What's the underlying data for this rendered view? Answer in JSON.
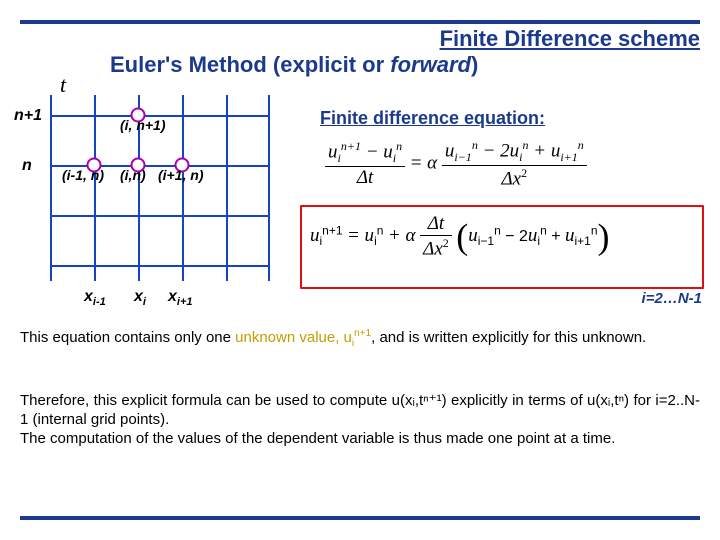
{
  "title_line1": "Finite Difference scheme",
  "title_line2_a": "Euler's Method (explicit or ",
  "title_line2_b": "forward",
  "title_line2_c": ")",
  "t_label": "t",
  "y_n1": "n+1",
  "y_n": "n",
  "stencil": {
    "top": "(i, n+1)",
    "left": "(i-1, n)",
    "mid": "(i,n)",
    "right": "(i+1, n)"
  },
  "xticks": {
    "xm1": "x",
    "xm1s": "i-1",
    "xi": "x",
    "xis": "i",
    "xp1": "x",
    "xp1s": "i+1"
  },
  "eq_heading": "Finite difference equation:",
  "range_note": "i=2…N-1",
  "para1_a": "This equation contains only one ",
  "para1_b": "unknown value, u",
  "para1_c": ", and is written explicitly for this unknown.",
  "para2": "Therefore, this explicit formula can be used to compute u(xᵢ,tⁿ⁺¹) explicitly in terms of u(xᵢ,tⁿ) for i=2..N-1 (internal grid points).\nThe computation of the values of the dependent variable is thus made one point at a time."
}
